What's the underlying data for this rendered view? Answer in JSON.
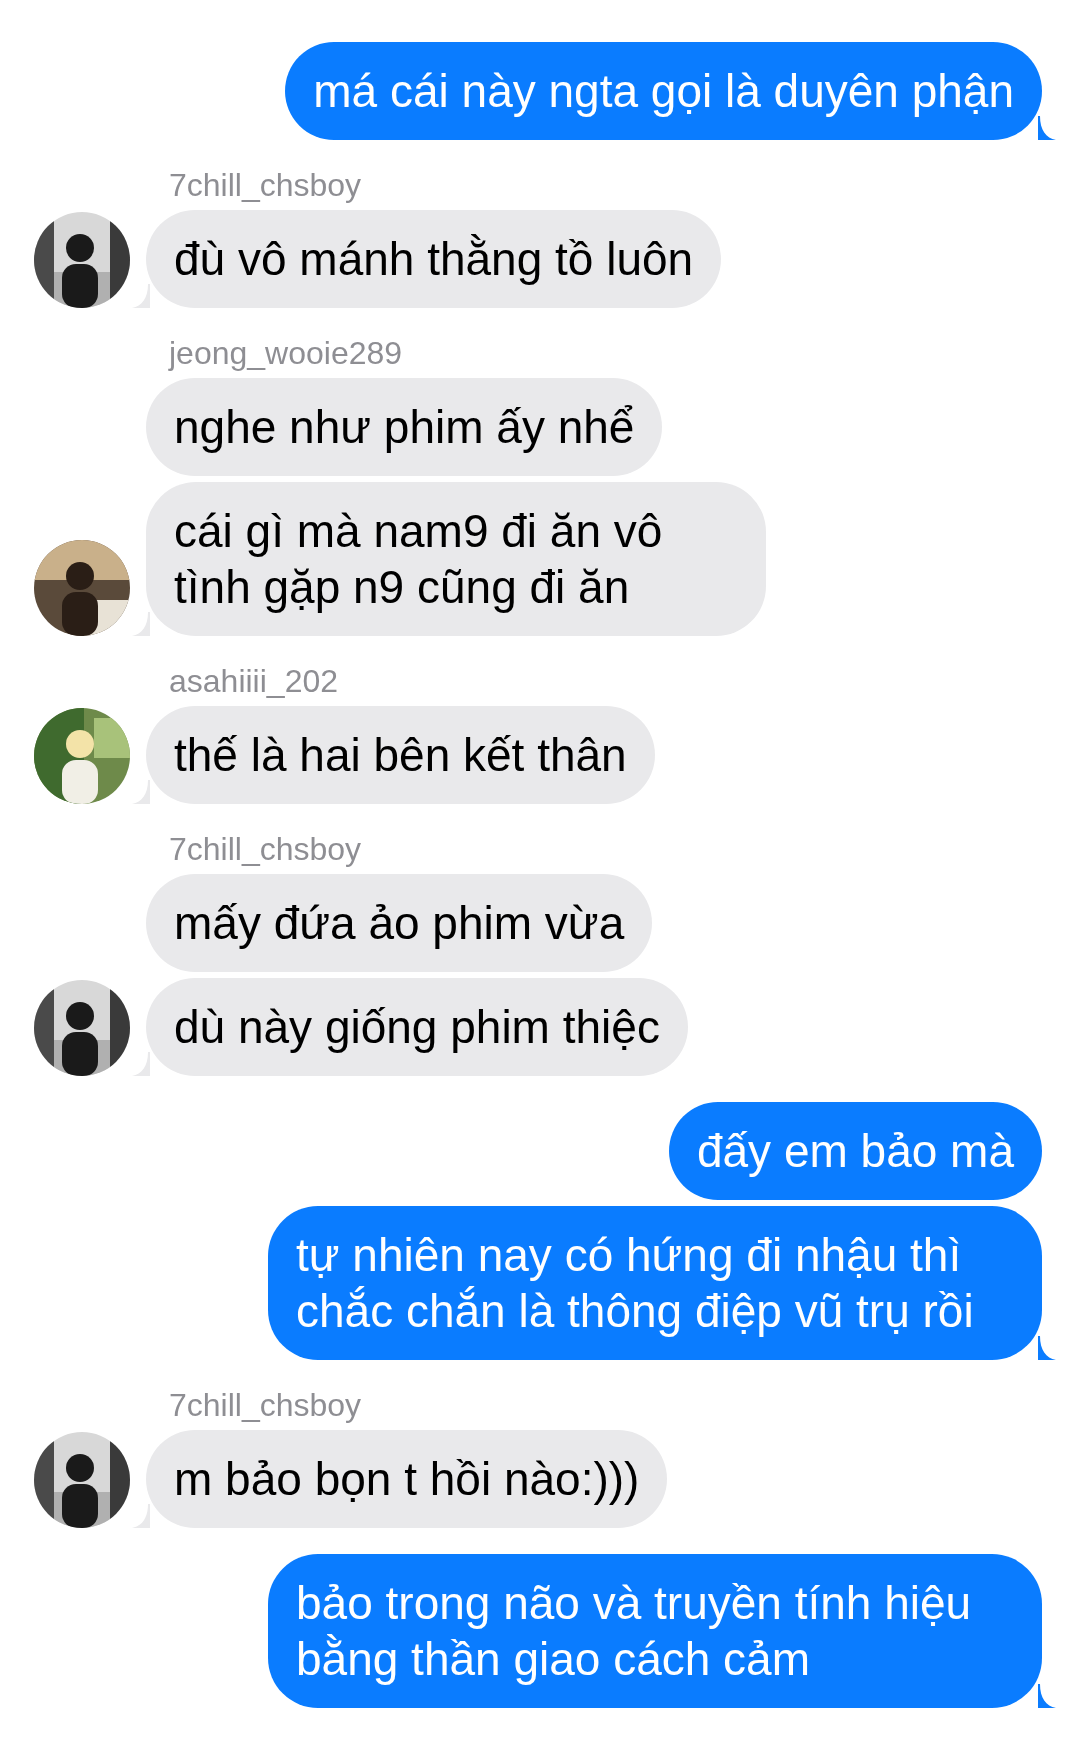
{
  "groups": [
    {
      "kind": "outgoing",
      "messages": [
        "má cái này ngta gọi là duyên phận"
      ]
    },
    {
      "kind": "incoming",
      "sender": "7chill_chsboy",
      "messages": [
        "đù vô mánh thằng tồ luôn"
      ]
    },
    {
      "kind": "incoming",
      "sender": "jeong_wooie289",
      "messages": [
        "nghe như phim ấy nhể",
        "cái gì mà nam9 đi ăn vô tình gặp n9 cũng đi ăn"
      ]
    },
    {
      "kind": "incoming",
      "sender": "asahiiii_202",
      "messages": [
        "thế là hai bên kết thân"
      ]
    },
    {
      "kind": "incoming",
      "sender": "7chill_chsboy",
      "messages": [
        "mấy đứa ảo phim vừa",
        "dù này giống phim thiệc"
      ]
    },
    {
      "kind": "outgoing",
      "messages": [
        "đấy em bảo mà",
        "tự nhiên nay có hứng đi nhậu thì chắc chắn là thông điệp vũ trụ rồi"
      ]
    },
    {
      "kind": "incoming",
      "sender": "7chill_chsboy",
      "messages": [
        "m bảo bọn t hồi nào:)))"
      ]
    },
    {
      "kind": "outgoing",
      "messages": [
        "bảo trong não và truyền tính hiệu bằng thần giao cách cảm"
      ]
    }
  ]
}
